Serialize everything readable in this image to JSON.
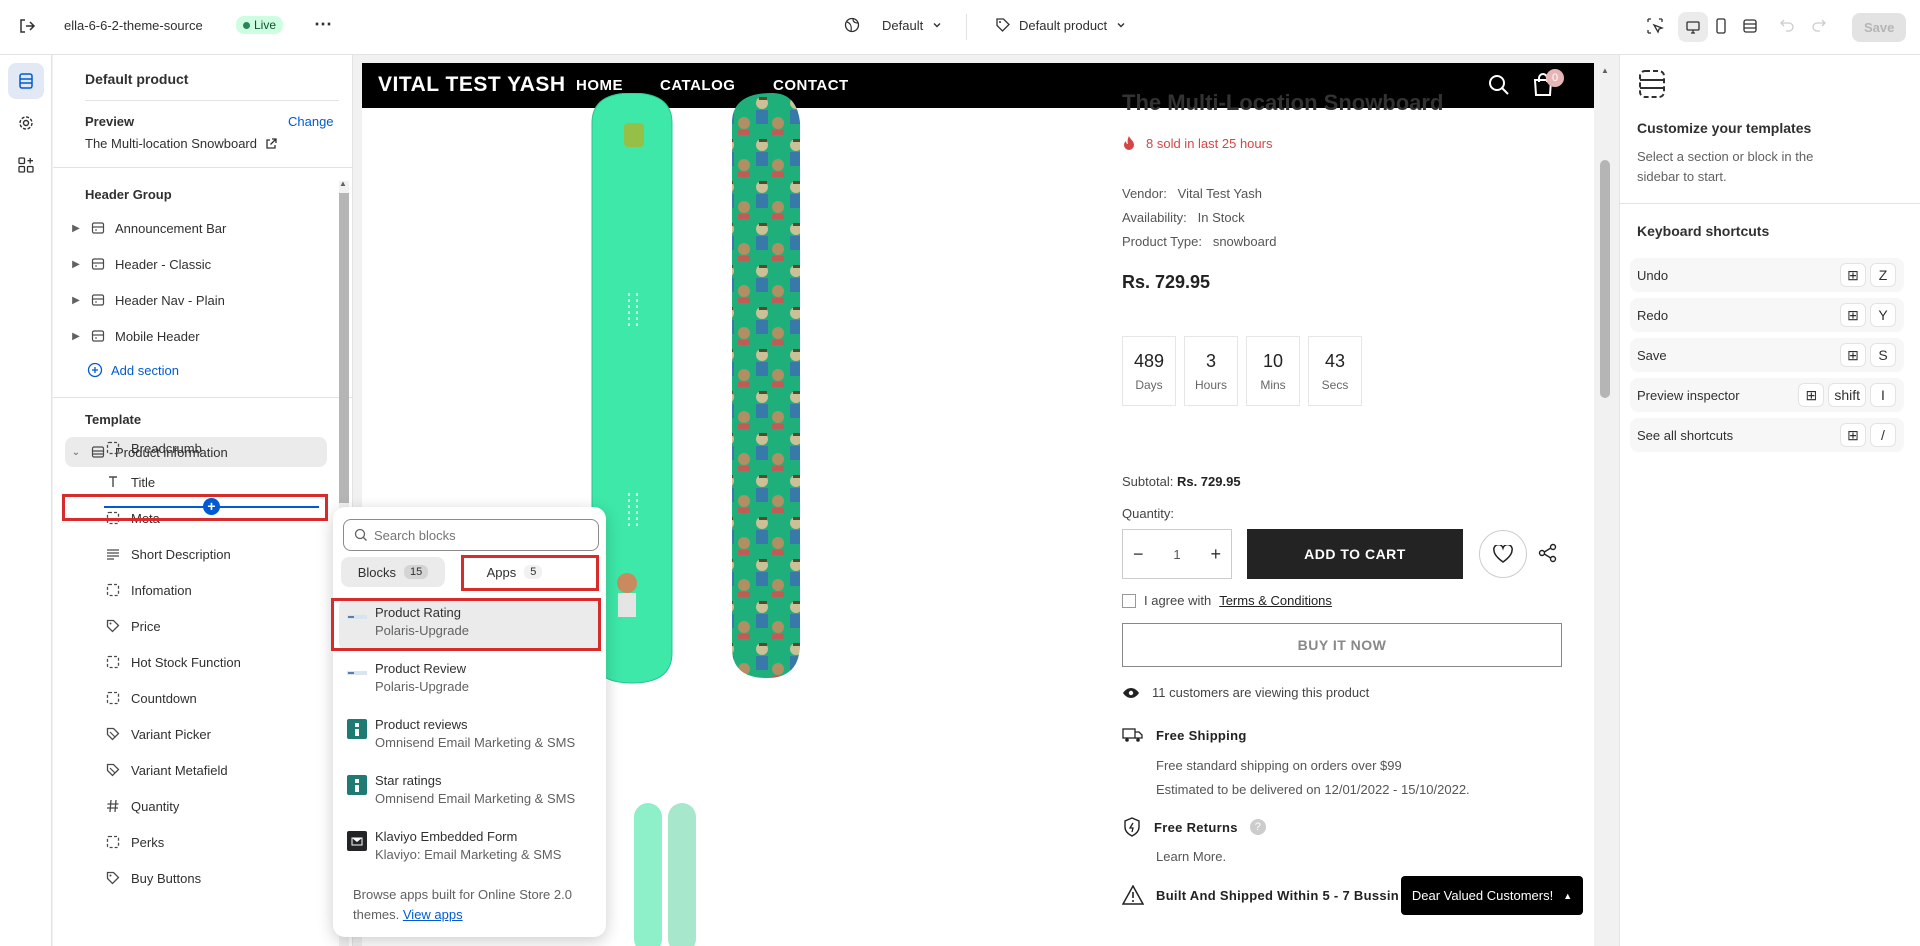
{
  "topbar": {
    "theme_name": "ella-6-6-2-theme-source",
    "live_label": "Live",
    "more_label": "⋯",
    "template_selector": "Default",
    "product_selector": "Default product",
    "save_label": "Save"
  },
  "sidebar": {
    "title": "Default product",
    "preview_label": "Preview",
    "change_label": "Change",
    "preview_value": "The Multi-location Snowboard",
    "header_group_label": "Header Group",
    "header_sections": [
      {
        "label": "Announcement Bar"
      },
      {
        "label": "Header - Classic"
      },
      {
        "label": "Header Nav - Plain"
      },
      {
        "label": "Mobile Header"
      }
    ],
    "add_section_label": "Add section",
    "template_label": "Template",
    "template_section": "Product information",
    "blocks": [
      {
        "label": "Breadcrumb",
        "icon": "dashed-square-icon"
      },
      {
        "label": "Title",
        "icon": "text-icon"
      },
      {
        "label": "Meta",
        "icon": "dashed-square-icon"
      },
      {
        "label": "Short Description",
        "icon": "paragraph-icon"
      },
      {
        "label": "Infomation",
        "icon": "dashed-square-icon"
      },
      {
        "label": "Price",
        "icon": "tag-icon"
      },
      {
        "label": "Hot Stock Function",
        "icon": "dashed-square-icon"
      },
      {
        "label": "Countdown",
        "icon": "dashed-square-icon"
      },
      {
        "label": "Variant Picker",
        "icon": "variant-icon"
      },
      {
        "label": "Variant Metafield",
        "icon": "variant-icon"
      },
      {
        "label": "Quantity",
        "icon": "hash-icon"
      },
      {
        "label": "Perks",
        "icon": "dashed-square-icon"
      },
      {
        "label": "Buy Buttons",
        "icon": "tag-icon"
      }
    ]
  },
  "popover": {
    "search_placeholder": "Search blocks",
    "tab_blocks": "Blocks",
    "tab_blocks_count": "15",
    "tab_apps": "Apps",
    "tab_apps_count": "5",
    "apps": [
      {
        "name": "Product Rating",
        "vendor": "Polaris-Upgrade"
      },
      {
        "name": "Product Review",
        "vendor": "Polaris-Upgrade"
      },
      {
        "name": "Product reviews",
        "vendor": "Omnisend Email Marketing & SMS"
      },
      {
        "name": "Star ratings",
        "vendor": "Omnisend Email Marketing & SMS"
      },
      {
        "name": "Klaviyo Embedded Form",
        "vendor": "Klaviyo: Email Marketing & SMS"
      }
    ],
    "footer_text": "Browse apps built for Online Store 2.0 themes.",
    "footer_link": "View apps"
  },
  "store": {
    "logo": "VITAL TEST YASH",
    "nav": [
      "HOME",
      "CATALOG",
      "CONTACT"
    ],
    "cart_count": "0",
    "product_title": "The Multi-Location Snowboard",
    "sold_text": "8 sold in last 25 hours",
    "vendor_label": "Vendor:",
    "vendor_value": "Vital Test Yash",
    "availability_label": "Availability:",
    "availability_value": "In Stock",
    "type_label": "Product Type:",
    "type_value": "snowboard",
    "price": "Rs. 729.95",
    "countdown": [
      {
        "value": "489",
        "unit": "Days"
      },
      {
        "value": "3",
        "unit": "Hours"
      },
      {
        "value": "10",
        "unit": "Mins"
      },
      {
        "value": "43",
        "unit": "Secs"
      }
    ],
    "subtotal_label": "Subtotal:",
    "subtotal_value": "Rs. 729.95",
    "quantity_label": "Quantity:",
    "quantity_value": "1",
    "add_to_cart": "ADD TO CART",
    "agree_text": "I agree with",
    "terms_link": "Terms & Conditions",
    "buy_now": "BUY IT NOW",
    "viewing_text": "11 customers are viewing this product",
    "free_shipping": "Free Shipping",
    "shipping_line1": "Free standard shipping on orders over $99",
    "shipping_line2": "Estimated to be delivered on 12/01/2022 - 15/10/2022.",
    "free_returns": "Free Returns",
    "learn_more": "Learn More.",
    "built_shipped": "Built And Shipped Within 5 - 7 Bussin",
    "toast": "Dear Valued Customers!"
  },
  "rightpanel": {
    "title": "Customize your templates",
    "desc": "Select a section or block in the sidebar to start.",
    "shortcuts_title": "Keyboard shortcuts",
    "shortcuts": [
      {
        "label": "Undo",
        "keys": [
          "⊞",
          "Z"
        ]
      },
      {
        "label": "Redo",
        "keys": [
          "⊞",
          "Y"
        ]
      },
      {
        "label": "Save",
        "keys": [
          "⊞",
          "S"
        ]
      },
      {
        "label": "Preview inspector",
        "keys": [
          "⊞",
          "shift",
          "I"
        ]
      },
      {
        "label": "See all shortcuts",
        "keys": [
          "⊞",
          "/"
        ]
      }
    ]
  },
  "colors": {
    "accent": "#005bd3",
    "highlight": "#d82c2c",
    "board_mint": "#3de8a8",
    "board_green": "#1faf7a"
  }
}
